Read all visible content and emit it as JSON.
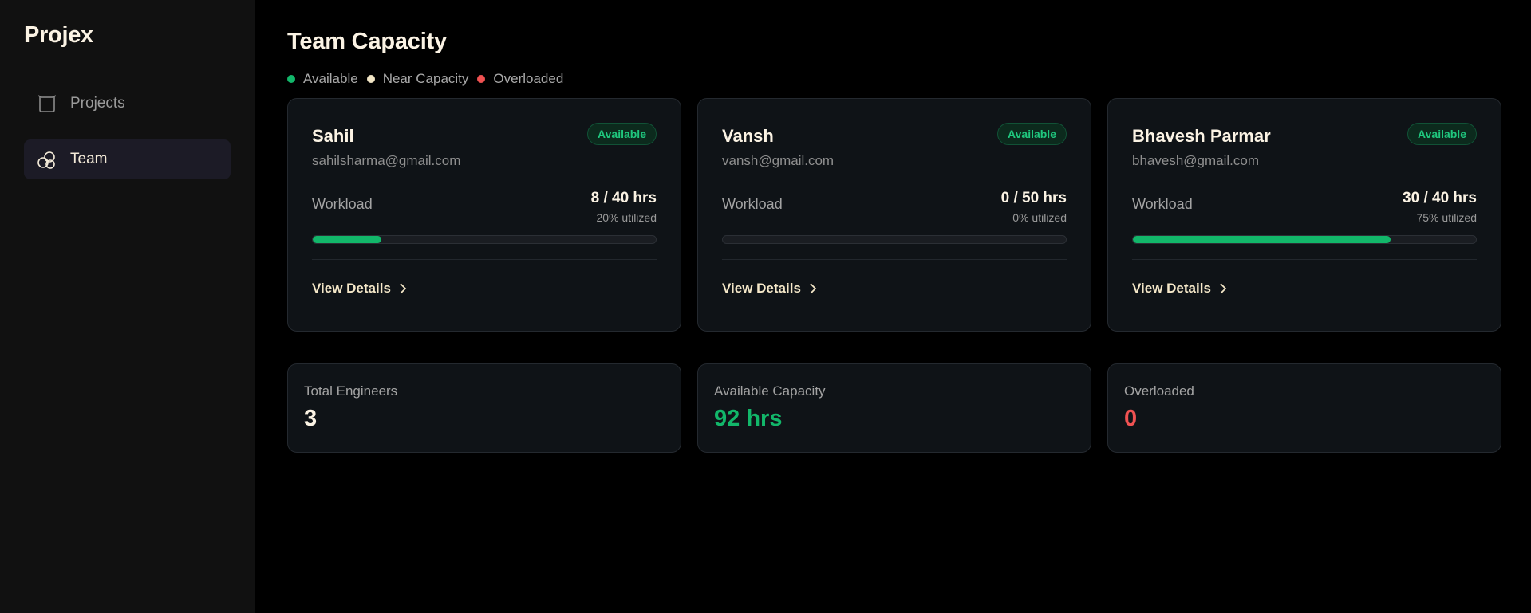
{
  "app": {
    "brand": "Projex"
  },
  "sidebar": {
    "items": [
      {
        "label": "Projects",
        "icon": "projects-icon",
        "active": false
      },
      {
        "label": "Team",
        "icon": "team-icon",
        "active": true
      }
    ]
  },
  "main": {
    "title": "Team Capacity",
    "legend": [
      {
        "label": "Available",
        "color": "#12b76a"
      },
      {
        "label": "Near Capacity",
        "color": "#f2e6c6"
      },
      {
        "label": "Overloaded",
        "color": "#f05252"
      }
    ],
    "members": [
      {
        "name": "Sahil",
        "email": "sahilsharma@gmail.com",
        "status": "Available",
        "workload_label": "Workload",
        "hours": "8 / 40 hrs",
        "utilization": "20% utilized",
        "progress_fraction": 0.2,
        "view_details": "View Details"
      },
      {
        "name": "Vansh",
        "email": "vansh@gmail.com",
        "status": "Available",
        "workload_label": "Workload",
        "hours": "0 / 50 hrs",
        "utilization": "0% utilized",
        "progress_fraction": 0,
        "view_details": "View Details"
      },
      {
        "name": "Bhavesh Parmar",
        "email": "bhavesh@gmail.com",
        "status": "Available",
        "workload_label": "Workload",
        "hours": "30 / 40 hrs",
        "utilization": "75% utilized",
        "progress_fraction": 0.75,
        "view_details": "View Details"
      }
    ],
    "stats": [
      {
        "label": "Total Engineers",
        "value": "3",
        "color": "#fbf3e4"
      },
      {
        "label": "Available Capacity",
        "value": "92 hrs",
        "color": "#12b76a"
      },
      {
        "label": "Overloaded",
        "value": "0",
        "color": "#f05252"
      }
    ]
  }
}
